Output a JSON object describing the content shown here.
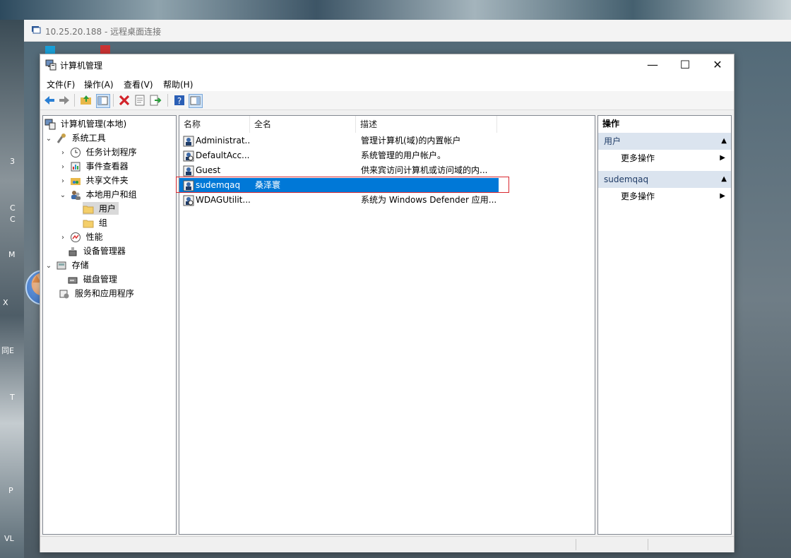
{
  "rdp_window": {
    "title": "10.25.20.188 - 远程桌面连接"
  },
  "desktop_fragments": [
    "3",
    "C",
    "C",
    "M",
    "X",
    "同E",
    "T",
    "P",
    "VL"
  ],
  "window": {
    "title": "计算机管理",
    "minimize": "—",
    "maximize": "☐",
    "close": "✕"
  },
  "menu": [
    "文件(F)",
    "操作(A)",
    "查看(V)",
    "帮助(H)"
  ],
  "tree": {
    "root": "计算机管理(本地)",
    "system_tools": "系统工具",
    "task_scheduler": "任务计划程序",
    "event_viewer": "事件查看器",
    "shared_folders": "共享文件夹",
    "local_users_groups": "本地用户和组",
    "users": "用户",
    "groups": "组",
    "performance": "性能",
    "device_manager": "设备管理器",
    "storage": "存储",
    "disk_management": "磁盘管理",
    "services_apps": "服务和应用程序"
  },
  "list": {
    "columns": [
      "名称",
      "全名",
      "描述"
    ],
    "rows": [
      {
        "name": "Administrat...",
        "fullname": "",
        "desc": "管理计算机(域)的内置帐户"
      },
      {
        "name": "DefaultAcc...",
        "fullname": "",
        "desc": "系统管理的用户帐户。"
      },
      {
        "name": "Guest",
        "fullname": "",
        "desc": "供来宾访问计算机或访问域的内..."
      },
      {
        "name": "sudemqaq",
        "fullname": "桑泽寰",
        "desc": ""
      },
      {
        "name": "WDAGUtilit...",
        "fullname": "",
        "desc": "系统为 Windows Defender 应用..."
      }
    ],
    "selected_index": 3
  },
  "actions": {
    "header": "操作",
    "section1": "用户",
    "section1_item": "更多操作",
    "section2": "sudemqaq",
    "section2_item": "更多操作"
  },
  "colors": {
    "selection": "#0078d7",
    "highlight_box": "#d9282f",
    "section_bg": "#dbe4ef"
  }
}
